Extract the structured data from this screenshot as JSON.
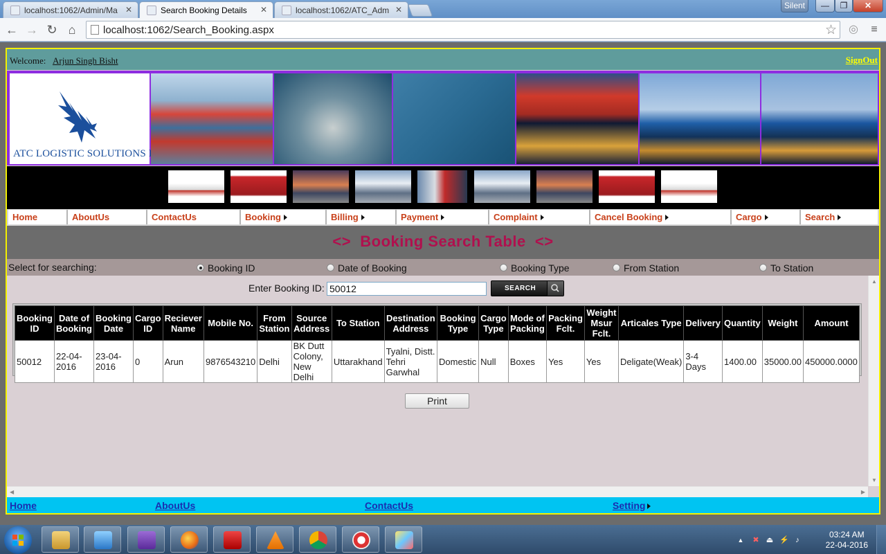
{
  "browser": {
    "tabs": [
      {
        "label": "localhost:1062/Admin/Ma",
        "active": false
      },
      {
        "label": "Search Booking Details",
        "active": true
      },
      {
        "label": "localhost:1062/ATC_Adm",
        "active": false
      }
    ],
    "profile_label": "Silent",
    "address": "localhost:1062/Search_Booking.aspx"
  },
  "header": {
    "welcome_label": "Welcome:",
    "user_name": "Arjun Singh Bisht",
    "signout_label": "SignOut",
    "logo_text": "ATC LOGISTIC SOLUTIONS LTD."
  },
  "menu": [
    {
      "label": "Home",
      "has_submenu": false
    },
    {
      "label": "AboutUs",
      "has_submenu": false
    },
    {
      "label": "ContactUs",
      "has_submenu": false
    },
    {
      "label": "Booking",
      "has_submenu": true
    },
    {
      "label": "Billing",
      "has_submenu": true
    },
    {
      "label": "Payment",
      "has_submenu": true
    },
    {
      "label": "Complaint",
      "has_submenu": true
    },
    {
      "label": "Cancel Booking",
      "has_submenu": true
    },
    {
      "label": "Cargo",
      "has_submenu": true
    },
    {
      "label": "Search",
      "has_submenu": true
    }
  ],
  "page_title": "<>  Booking Search Table  <>",
  "search": {
    "select_label": "Select for searching:",
    "options": [
      {
        "label": "Booking ID",
        "checked": true
      },
      {
        "label": "Date of Booking",
        "checked": false
      },
      {
        "label": "Booking Type",
        "checked": false
      },
      {
        "label": "From Station",
        "checked": false
      },
      {
        "label": "To Station",
        "checked": false
      }
    ],
    "input_label": "Enter Booking ID:",
    "input_value": "50012",
    "button_label": "SEARCH"
  },
  "table": {
    "columns": [
      "Booking ID",
      "Date of Booking",
      "Booking Date",
      "Cargo ID",
      "Reciever Name",
      "Mobile No.",
      "From Station",
      "Source Address",
      "To Station",
      "Destination Address",
      "Booking Type",
      "Cargo Type",
      "Mode of Packing",
      "Packing Fclt.",
      "Weight Msur Fclt.",
      "Articales Type",
      "Delivery",
      "Quantity",
      "Weight",
      "Amount"
    ],
    "rows": [
      [
        "50012",
        "22-04-2016",
        "23-04-2016",
        "0",
        "Arun",
        "9876543210",
        "Delhi",
        "BK Dutt Colony, New Delhi",
        "Uttarakhand",
        "Tyalni, Distt. Tehri Garwhal",
        "Domestic",
        "Null",
        "Boxes",
        "Yes",
        "Yes",
        "Deligate(Weak)",
        "3-4 Days",
        "1400.00",
        "35000.00",
        "450000.0000"
      ]
    ]
  },
  "print_label": "Print",
  "footer": [
    {
      "label": "Home",
      "has_submenu": false
    },
    {
      "label": "AboutUs",
      "has_submenu": false
    },
    {
      "label": "ContactUs",
      "has_submenu": false
    },
    {
      "label": "Setting",
      "has_submenu": true
    }
  ],
  "taskbar": {
    "apps": [
      "explorer-icon",
      "media-player-icon",
      "visual-studio-icon",
      "firefox-icon",
      "acrobat-icon",
      "vlc-icon",
      "chrome-icon",
      "ccleaner-icon",
      "paint-icon"
    ],
    "time": "03:24 AM",
    "date": "22-04-2016"
  },
  "colors": {
    "menu_text": "#c8401a",
    "title_text": "#b0104e",
    "footer_bg": "#00c4f2",
    "welcome_bg": "#5f9c9c",
    "frame_border": "#f4f000"
  }
}
